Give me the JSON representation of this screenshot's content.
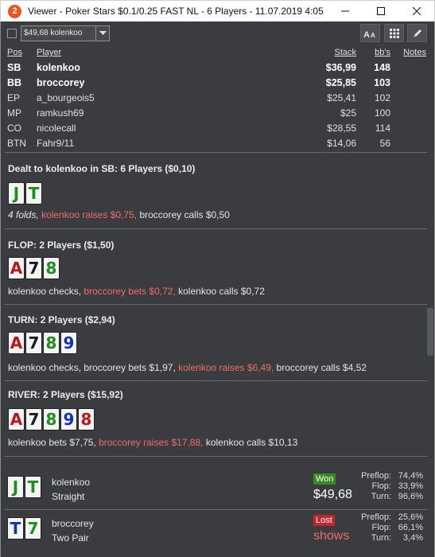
{
  "window": {
    "app_icon": "2",
    "title": "Viewer - Poker Stars $0.1/0.25 FAST NL - 6 Players - 11.07.2019 4:05"
  },
  "toolbar": {
    "select_value": "$49,68 kolenkoo",
    "icons": [
      "font-size-icon",
      "grid-icon",
      "pencil-icon"
    ]
  },
  "players": {
    "headers": {
      "pos": "Pos",
      "player": "Player",
      "stack": "Stack",
      "bb": "bb's",
      "notes": "Notes"
    },
    "rows": [
      {
        "pos": "SB",
        "name": "kolenkoo",
        "stack": "$36,99",
        "bb": "148"
      },
      {
        "pos": "BB",
        "name": "broccorey",
        "stack": "$25,85",
        "bb": "103"
      },
      {
        "pos": "EP",
        "name": "a_bourgeois5",
        "stack": "$25,41",
        "bb": "102"
      },
      {
        "pos": "MP",
        "name": "ramkush69",
        "stack": "$25",
        "bb": "100"
      },
      {
        "pos": "CO",
        "name": "nicolecall",
        "stack": "$28,55",
        "bb": "114"
      },
      {
        "pos": "BTN",
        "name": "Fahr9/11",
        "stack": "$14,06",
        "bb": "56"
      }
    ]
  },
  "preflop": {
    "title": "Dealt to kolenkoo in SB: 6 Players ($0,10)",
    "cards": [
      {
        "rank": "J",
        "suit": "c"
      },
      {
        "rank": "T",
        "suit": "c"
      }
    ],
    "action": {
      "a": "4 folds,",
      "b": " kolenkoo raises $0,75,",
      "c": " broccorey calls $0,50"
    }
  },
  "flop": {
    "title": "FLOP: 2 Players ($1,50)",
    "cards": [
      {
        "rank": "A",
        "suit": "h"
      },
      {
        "rank": "7",
        "suit": "s"
      },
      {
        "rank": "8",
        "suit": "c"
      }
    ],
    "action": {
      "a": "kolenkoo checks,",
      "b": " broccorey bets $0,72,",
      "c": " kolenkoo calls $0,72"
    }
  },
  "turn": {
    "title": "TURN: 2 Players ($2,94)",
    "cards": [
      {
        "rank": "A",
        "suit": "h"
      },
      {
        "rank": "7",
        "suit": "s"
      },
      {
        "rank": "8",
        "suit": "c"
      },
      {
        "rank": "9",
        "suit": "d"
      }
    ],
    "action": {
      "a": "kolenkoo checks, broccorey bets $1,97,",
      "b": " kolenkoo raises $6,49,",
      "c": " broccorey calls $4,52"
    }
  },
  "river": {
    "title": "RIVER: 2 Players ($15,92)",
    "cards": [
      {
        "rank": "A",
        "suit": "h"
      },
      {
        "rank": "7",
        "suit": "s"
      },
      {
        "rank": "8",
        "suit": "c"
      },
      {
        "rank": "9",
        "suit": "d"
      },
      {
        "rank": "8",
        "suit": "h"
      }
    ],
    "action": {
      "a": "kolenkoo bets $7,75,",
      "b": " broccorey raises $17,88,",
      "c": " kolenkoo calls $10,13"
    }
  },
  "results": [
    {
      "name": "kolenkoo",
      "hand": "Straight",
      "cards": [
        {
          "rank": "J",
          "suit": "c"
        },
        {
          "rank": "T",
          "suit": "c"
        }
      ],
      "badge": "Won",
      "amount": "$49,68",
      "stats": [
        {
          "label": "Preflop:",
          "value": "74,4%"
        },
        {
          "label": "Flop:",
          "value": "33,9%"
        },
        {
          "label": "Turn:",
          "value": "96,6%"
        }
      ]
    },
    {
      "name": "broccorey",
      "hand": "Two Pair",
      "cards": [
        {
          "rank": "T",
          "suit": "d"
        },
        {
          "rank": "7",
          "suit": "c"
        }
      ],
      "badge": "Lost",
      "amount": "shows",
      "stats": [
        {
          "label": "Preflop:",
          "value": "25,6%"
        },
        {
          "label": "Flop:",
          "value": "66,1%"
        },
        {
          "label": "Turn:",
          "value": "3,4%"
        }
      ]
    }
  ],
  "colors": {
    "background": "#3a3c3f",
    "highlight_action": "#ef6b6b",
    "won_badge": "#3a8a1e",
    "lost_badge": "#c0262c",
    "suit_spades": "#1a1a1a",
    "suit_hearts": "#c0141c",
    "suit_clubs": "#1e8e1e",
    "suit_diamonds": "#1232b4"
  }
}
